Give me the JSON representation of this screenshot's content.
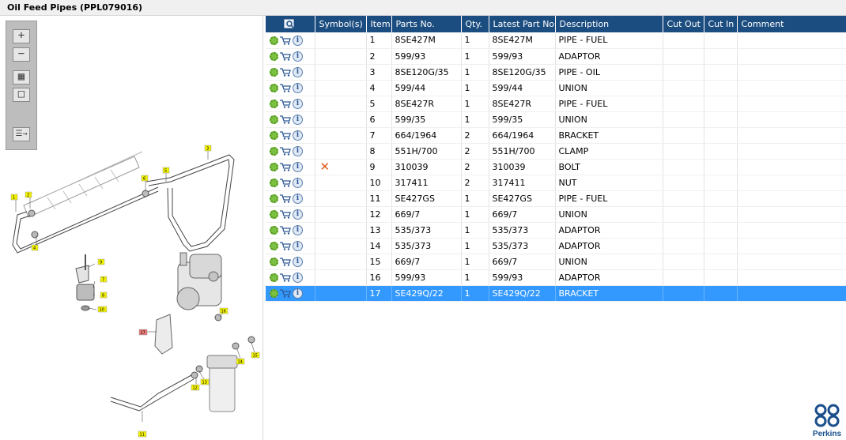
{
  "title": "Oil Feed Pipes (PPL079016)",
  "toolbar": {
    "zoom_in": "+",
    "zoom_out": "−",
    "fit": "▦",
    "reset": "□",
    "list": "☰→"
  },
  "diagram": {
    "callouts": [
      "1",
      "2",
      "3",
      "4",
      "5",
      "6",
      "7",
      "8",
      "9",
      "10",
      "11",
      "12",
      "13",
      "14",
      "15",
      "16",
      "17"
    ]
  },
  "table": {
    "headers": {
      "icons": "",
      "symbols": "Symbol(s)",
      "item": "Item",
      "parts_no": "Parts No.",
      "qty": "Qty.",
      "latest": "Latest Part No.",
      "description": "Description",
      "cut_out": "Cut Out",
      "cut_in": "Cut In",
      "comment": "Comment"
    },
    "rows": [
      {
        "symbol": "",
        "item": "1",
        "part": "8SE427M",
        "qty": "1",
        "latest": "8SE427M",
        "desc": "PIPE - FUEL"
      },
      {
        "symbol": "",
        "item": "2",
        "part": "599/93",
        "qty": "1",
        "latest": "599/93",
        "desc": "ADAPTOR"
      },
      {
        "symbol": "",
        "item": "3",
        "part": "8SE120G/35",
        "qty": "1",
        "latest": "8SE120G/35",
        "desc": "PIPE - OIL"
      },
      {
        "symbol": "",
        "item": "4",
        "part": "599/44",
        "qty": "1",
        "latest": "599/44",
        "desc": "UNION"
      },
      {
        "symbol": "",
        "item": "5",
        "part": "8SE427R",
        "qty": "1",
        "latest": "8SE427R",
        "desc": "PIPE - FUEL"
      },
      {
        "symbol": "",
        "item": "6",
        "part": "599/35",
        "qty": "1",
        "latest": "599/35",
        "desc": "UNION"
      },
      {
        "symbol": "",
        "item": "7",
        "part": "664/1964",
        "qty": "2",
        "latest": "664/1964",
        "desc": "BRACKET"
      },
      {
        "symbol": "",
        "item": "8",
        "part": "551H/700",
        "qty": "2",
        "latest": "551H/700",
        "desc": "CLAMP"
      },
      {
        "symbol": "✕",
        "item": "9",
        "part": "310039",
        "qty": "2",
        "latest": "310039",
        "desc": "BOLT"
      },
      {
        "symbol": "",
        "item": "10",
        "part": "317411",
        "qty": "2",
        "latest": "317411",
        "desc": "NUT"
      },
      {
        "symbol": "",
        "item": "11",
        "part": "SE427GS",
        "qty": "1",
        "latest": "SE427GS",
        "desc": "PIPE - FUEL"
      },
      {
        "symbol": "",
        "item": "12",
        "part": "669/7",
        "qty": "1",
        "latest": "669/7",
        "desc": "UNION"
      },
      {
        "symbol": "",
        "item": "13",
        "part": "535/373",
        "qty": "1",
        "latest": "535/373",
        "desc": "ADAPTOR"
      },
      {
        "symbol": "",
        "item": "14",
        "part": "535/373",
        "qty": "1",
        "latest": "535/373",
        "desc": "ADAPTOR"
      },
      {
        "symbol": "",
        "item": "15",
        "part": "669/7",
        "qty": "1",
        "latest": "669/7",
        "desc": "UNION"
      },
      {
        "symbol": "",
        "item": "16",
        "part": "599/93",
        "qty": "1",
        "latest": "599/93",
        "desc": "ADAPTOR"
      },
      {
        "symbol": "",
        "item": "17",
        "part": "SE429Q/22",
        "qty": "1",
        "latest": "SE429Q/22",
        "desc": "BRACKET"
      }
    ],
    "selected_item": "17"
  },
  "logo": {
    "text": "Perkins"
  },
  "colors": {
    "header_bg": "#1c4d80",
    "selected_row": "#3399ff",
    "callout_fill": "#f2f200",
    "highlight_callout": "#e87878",
    "symbol_x": "#e05a1a"
  }
}
